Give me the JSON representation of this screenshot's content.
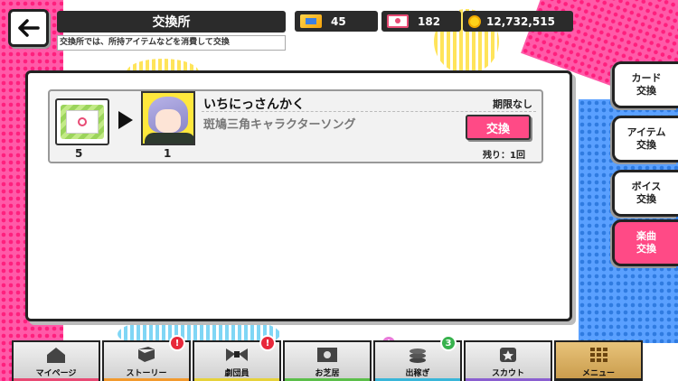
{
  "header": {
    "title": "交換所",
    "subtitle": "交換所では、所持アイテムなどを消費して交換"
  },
  "resources": {
    "ticket_a": "45",
    "ticket_b": "182",
    "coins": "12,732,515"
  },
  "exchange_item": {
    "cost_qty": "5",
    "reward_qty": "1",
    "name": "いちにっさんかく",
    "description": "斑鳩三角キャラクターソング",
    "deadline": "期限なし",
    "button_label": "交換",
    "remaining": "残り：1回"
  },
  "side_tabs": [
    {
      "line1": "カード",
      "line2": "交換"
    },
    {
      "line1": "アイテム",
      "line2": "交換"
    },
    {
      "line1": "ボイス",
      "line2": "交換"
    },
    {
      "line1": "楽曲",
      "line2": "交換"
    }
  ],
  "bottom_nav": [
    {
      "label": "マイページ",
      "badge": ""
    },
    {
      "label": "ストーリー",
      "badge": "!"
    },
    {
      "label": "劇団員",
      "badge": "!"
    },
    {
      "label": "お芝居",
      "badge": "!"
    },
    {
      "label": "出稼ぎ",
      "badge": "3"
    },
    {
      "label": "スカウト",
      "badge": ""
    },
    {
      "label": "メニュー",
      "badge": ""
    }
  ],
  "colors": {
    "accent_pink": "#ff4a86",
    "badge_red": "#e8283a",
    "badge_pink": "#e77ad8",
    "badge_green": "#37b24d"
  }
}
